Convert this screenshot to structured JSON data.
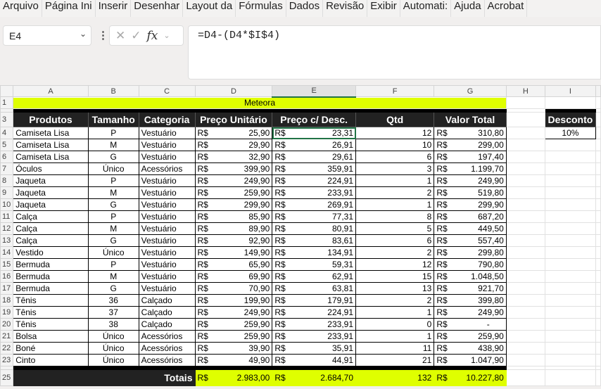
{
  "menu": [
    "Arquivo",
    "Página Ini",
    "Inserir",
    "Desenhar",
    "Layout da",
    "Fórmulas",
    "Dados",
    "Revisão",
    "Exibir",
    "Automati:",
    "Ajuda",
    "Acrobat"
  ],
  "name_box": "E4",
  "formula": "=D4-(D4*$I$4)",
  "columns": [
    "A",
    "B",
    "C",
    "D",
    "E",
    "F",
    "G",
    "H",
    "I"
  ],
  "title": "Meteora",
  "headers": [
    "Produtos",
    "Tamanho",
    "Categoria",
    "Preço Unitário",
    "Preço c/ Desc.",
    "Qtd",
    "Valor Total"
  ],
  "currency": "R$",
  "discount": {
    "label": "Desconto",
    "value": "10%"
  },
  "rows": [
    [
      "4",
      "Camiseta Lisa",
      "P",
      "Vestuário",
      "25,90",
      "23,31",
      "12",
      "310,80"
    ],
    [
      "5",
      "Camiseta Lisa",
      "M",
      "Vestuário",
      "29,90",
      "26,91",
      "10",
      "299,00"
    ],
    [
      "6",
      "Camiseta Lisa",
      "G",
      "Vestuário",
      "32,90",
      "29,61",
      "6",
      "197,40"
    ],
    [
      "7",
      "Óculos",
      "Único",
      "Acessórios",
      "399,90",
      "359,91",
      "3",
      "1.199,70"
    ],
    [
      "8",
      "Jaqueta",
      "P",
      "Vestuário",
      "249,90",
      "224,91",
      "1",
      "249,90"
    ],
    [
      "9",
      "Jaqueta",
      "M",
      "Vestuário",
      "259,90",
      "233,91",
      "2",
      "519,80"
    ],
    [
      "10",
      "Jaqueta",
      "G",
      "Vestuário",
      "299,90",
      "269,91",
      "1",
      "299,90"
    ],
    [
      "11",
      "Calça",
      "P",
      "Vestuário",
      "85,90",
      "77,31",
      "8",
      "687,20"
    ],
    [
      "12",
      "Calça",
      "M",
      "Vestuário",
      "89,90",
      "80,91",
      "5",
      "449,50"
    ],
    [
      "13",
      "Calça",
      "G",
      "Vestuário",
      "92,90",
      "83,61",
      "6",
      "557,40"
    ],
    [
      "14",
      "Vestido",
      "Único",
      "Vestuário",
      "149,90",
      "134,91",
      "2",
      "299,80"
    ],
    [
      "15",
      "Bermuda",
      "P",
      "Vestuário",
      "65,90",
      "59,31",
      "12",
      "790,80"
    ],
    [
      "16",
      "Bermuda",
      "M",
      "Vestuário",
      "69,90",
      "62,91",
      "15",
      "1.048,50"
    ],
    [
      "17",
      "Bermuda",
      "G",
      "Vestuário",
      "70,90",
      "63,81",
      "13",
      "921,70"
    ],
    [
      "18",
      "Tênis",
      "36",
      "Calçado",
      "199,90",
      "179,91",
      "2",
      "399,80"
    ],
    [
      "19",
      "Tênis",
      "37",
      "Calçado",
      "249,90",
      "224,91",
      "1",
      "249,90"
    ],
    [
      "20",
      "Tênis",
      "38",
      "Calçado",
      "259,90",
      "233,91",
      "0",
      "-"
    ],
    [
      "21",
      "Bolsa",
      "Único",
      "Acessórios",
      "259,90",
      "233,91",
      "1",
      "259,90"
    ],
    [
      "22",
      "Boné",
      "Único",
      "Acessórios",
      "39,90",
      "35,91",
      "11",
      "438,90"
    ],
    [
      "23",
      "Cinto",
      "Único",
      "Acessórios",
      "49,90",
      "44,91",
      "21",
      "1.047,90"
    ]
  ],
  "totals": {
    "row": "25",
    "label": "Totais",
    "preco": "2.983,00",
    "desc": "2.684,70",
    "qtd": "132",
    "valor": "10.227,80"
  }
}
